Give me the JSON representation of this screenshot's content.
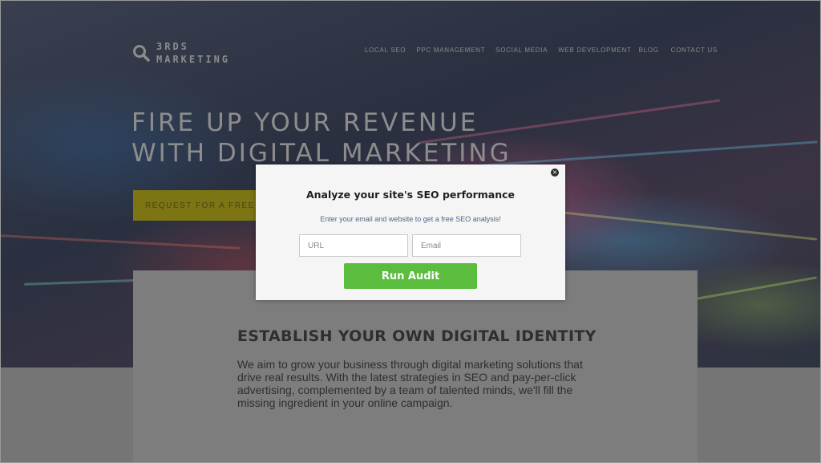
{
  "brand": {
    "line1": "3RDS",
    "line2": "MARKETING"
  },
  "nav": [
    "LOCAL SEO",
    "PPC MANAGEMENT",
    "SOCIAL MEDIA",
    "WEB DEVELOPMENT",
    "BLOG",
    "CONTACT US"
  ],
  "hero": {
    "heading_line1": "FIRE UP YOUR REVENUE",
    "heading_line2": "WITH DIGITAL MARKETING",
    "cta_label": "REQUEST FOR A FREE A"
  },
  "section": {
    "title": "ESTABLISH YOUR OWN DIGITAL IDENTITY",
    "body": "We aim to grow your business through digital marketing solutions that drive real results. With the latest strategies in SEO and pay-per-click advertising, complemented by a team of talented minds, we'll fill the missing ingredient in your online campaign."
  },
  "modal": {
    "close_symbol": "×",
    "title": "Analyze your site's SEO performance",
    "subtitle": "Enter your email and website to get a free SEO analysis!",
    "url_placeholder": "URL",
    "email_placeholder": "Email",
    "button_label": "Run Audit"
  },
  "colors": {
    "cta_bg": "#7d7514",
    "button_green": "#5bbd3e",
    "modal_bg": "#f5f5f5"
  },
  "icons": {
    "logo": "search-icon"
  }
}
